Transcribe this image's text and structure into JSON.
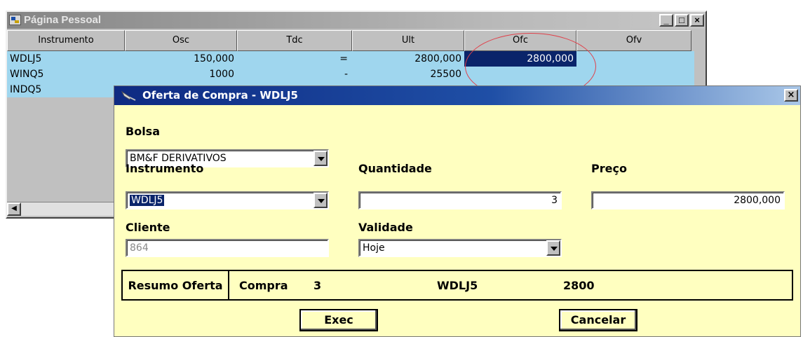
{
  "back_window": {
    "title": "Página Pessoal",
    "controls": {
      "minimize": "_",
      "maximize": "□",
      "close": "×"
    },
    "columns": [
      "Instrumento",
      "Osc",
      "Tdc",
      "Ult",
      "Ofc",
      "Ofv"
    ],
    "rows": [
      {
        "instrumento": "WDLJ5",
        "osc": "150,000",
        "tdc": "=",
        "ult": "2800,000",
        "ofc": "2800,000",
        "ofv": ""
      },
      {
        "instrumento": "WINQ5",
        "osc": "1000",
        "tdc": "-",
        "ult": "25500",
        "ofc": "",
        "ofv": ""
      },
      {
        "instrumento": "INDQ5",
        "osc": "",
        "tdc": "",
        "ult": "",
        "ofc": "",
        "ofv": ""
      }
    ]
  },
  "dialog": {
    "title": "Oferta de Compra -  WDLJ5",
    "close_label": "×",
    "bolsa": {
      "label": "Bolsa",
      "value": "BM&F DERIVATIVOS"
    },
    "instrumento": {
      "label": "Instrumento",
      "value": "WDLJ5"
    },
    "quantidade": {
      "label": "Quantidade",
      "value": "3"
    },
    "preco": {
      "label": "Preço",
      "value": "2800,000"
    },
    "cliente": {
      "label": "Cliente",
      "value": "864"
    },
    "validade": {
      "label": "Validade",
      "value": "Hoje"
    },
    "resumo": {
      "label": "Resumo Oferta",
      "tipo": "Compra",
      "quantidade": "3",
      "instrumento": "WDLJ5",
      "preco": "2800"
    },
    "buttons": {
      "exec": "Exec",
      "cancelar": "Cancelar"
    }
  },
  "colors": {
    "row_highlight": "#9fd6ee",
    "selected_cell": "#0a246a",
    "dialog_bg": "#ffffc0",
    "annotation": "#e0404a"
  }
}
